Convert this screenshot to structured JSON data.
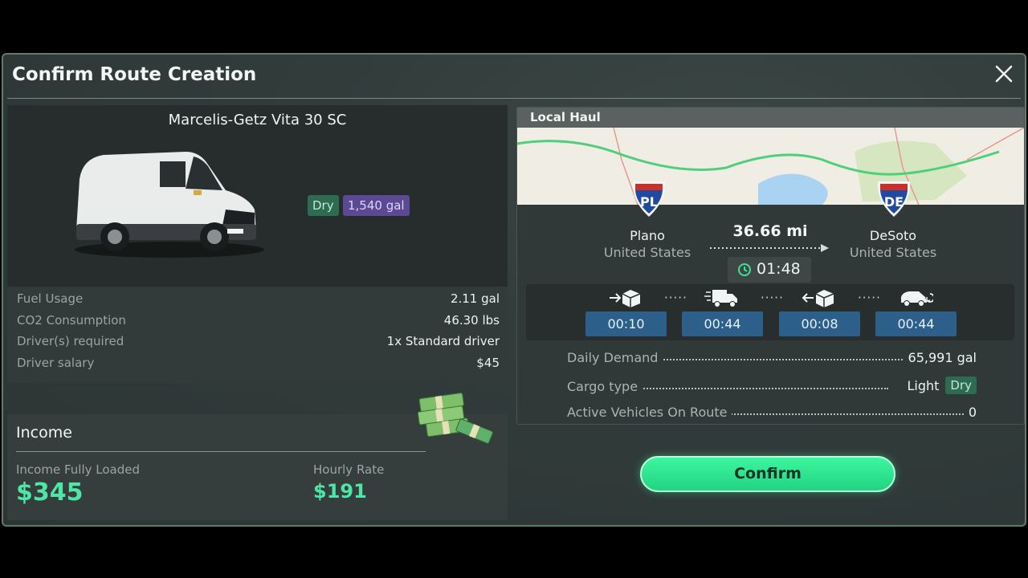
{
  "modal": {
    "title": "Confirm Route Creation"
  },
  "vehicle": {
    "name": "Marcelis-Getz Vita 30 SC",
    "cargo_tag": "Dry",
    "capacity_tag": "1,540 gal",
    "stats": [
      {
        "label": "Fuel Usage",
        "value": "2.11 gal"
      },
      {
        "label": "CO2 Consumption",
        "value": "46.30 lbs"
      },
      {
        "label": "Driver(s) required",
        "value": "1x Standard driver"
      },
      {
        "label": "Driver salary",
        "value": "$45"
      }
    ]
  },
  "income": {
    "title": "Income",
    "fully_loaded_label": "Income Fully Loaded",
    "fully_loaded_value": "$345",
    "hourly_label": "Hourly Rate",
    "hourly_value": "$191"
  },
  "route": {
    "type": "Local Haul",
    "origin": {
      "code": "PL",
      "city": "Plano",
      "country": "United States"
    },
    "destination": {
      "code": "DE",
      "city": "DeSoto",
      "country": "United States"
    },
    "distance": "36.66 mi",
    "duration": "01:48",
    "stages": [
      {
        "icon": "load-cargo-icon",
        "time": "00:10"
      },
      {
        "icon": "delivery-truck-icon",
        "time": "00:44"
      },
      {
        "icon": "unload-cargo-icon",
        "time": "00:08"
      },
      {
        "icon": "return-van-icon",
        "time": "00:44"
      }
    ],
    "daily_demand_label": "Daily Demand",
    "daily_demand_value": "65,991 gal",
    "cargo_type_label": "Cargo type",
    "cargo_type_value": "Light",
    "cargo_type_tag": "Dry",
    "active_vehicles_label": "Active Vehicles On Route",
    "active_vehicles_value": "0"
  },
  "actions": {
    "confirm_label": "Confirm"
  },
  "colors": {
    "accent": "#2fe38f",
    "panel": "#313938",
    "stage_time": "#2c5f8a",
    "dry_tag": "#2f6a52",
    "capacity_tag": "#5b4a93"
  }
}
